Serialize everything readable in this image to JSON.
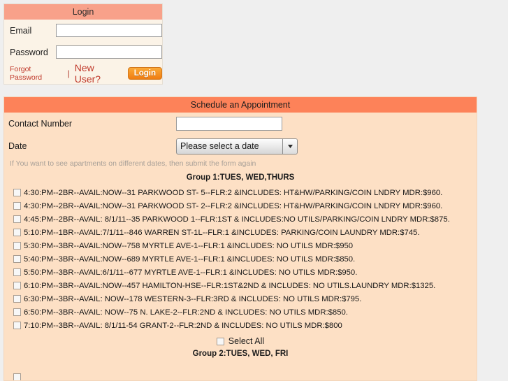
{
  "login": {
    "header": "Login",
    "email_label": "Email",
    "email_value": "",
    "email_placeholder": "",
    "password_label": "Password",
    "password_value": "",
    "password_placeholder": "",
    "forgot_password_label": "Forgot Password",
    "separator": "|",
    "new_user_label": "New User?",
    "login_button_label": "Login",
    "header_color": "#f8a18a",
    "button_color": "#f07d12",
    "link_color": "#c0392b"
  },
  "appointment": {
    "header": "Schedule an Appointment",
    "header_color": "#fd8259",
    "panel_color": "#fde0c5",
    "contact_number_label": "Contact Number",
    "contact_number_value": "",
    "contact_number_placeholder": "",
    "date_label": "Date",
    "date_selected": "Please select a date",
    "date_options": [
      "Please select a date"
    ],
    "hint": "If You want to see apartments on different dates, then submit the form again",
    "groups": [
      {
        "title": "Group 1:TUES, WED,THURS",
        "items": [
          {
            "label": "4:30:PM--2BR--AVAIL:NOW--31 PARKWOOD ST- 5--FLR:2 &INCLUDES: HT&HW/PARKING/COIN LNDRY MDR:$960.",
            "checked": false
          },
          {
            "label": "4:30:PM--2BR--AVAIL:NOW--31 PARKWOOD ST- 2--FLR:2 &INCLUDES: HT&HW/PARKING/COIN LNDRY MDR:$960.",
            "checked": false
          },
          {
            "label": "4:45:PM--2BR--AVAIL: 8/1/11--35 PARKWOOD 1--FLR:1ST & INCLUDES:NO UTILS/PARKING/COIN LNDRY MDR:$875.",
            "checked": false
          },
          {
            "label": "5:10:PM--1BR--AVAIL:7/1/11--846 WARREN ST-1L--FLR:1 &INCLUDES: PARKING/COIN LAUNDRY MDR:$745.",
            "checked": false
          },
          {
            "label": "5:30:PM--3BR--AVAIL:NOW--758 MYRTLE AVE-1--FLR:1 &INCLUDES: NO UTILS MDR:$950",
            "checked": false
          },
          {
            "label": "5:40:PM--3BR--AVAIL:NOW--689 MYRTLE AVE-1--FLR:1 &INCLUDES: NO UTILS MDR:$850.",
            "checked": false
          },
          {
            "label": "5:50:PM--3BR--AVAIL:6/1/11--677 MYRTLE AVE-1--FLR:1 &INCLUDES: NO UTILS MDR:$950.",
            "checked": false
          },
          {
            "label": "6:10:PM--3BR--AVAIL:NOW--457 HAMILTON-HSE--FLR:1ST&2ND & INCLUDES: NO UTILS.LAUNDRY MDR:$1325.",
            "checked": false
          },
          {
            "label": "6:30:PM--3BR--AVAIL: NOW--178 WESTERN-3--FLR:3RD & INCLUDES: NO UTILS MDR:$795.",
            "checked": false
          },
          {
            "label": "6:50:PM--3BR--AVAIL: NOW--75 N. LAKE-2--FLR:2ND & INCLUDES: NO UTILS MDR:$850.",
            "checked": false
          },
          {
            "label": "7:10:PM--3BR--AVAIL: 8/1/11-54 GRANT-2--FLR:2ND & INCLUDES: NO UTILS MDR:$800",
            "checked": false
          }
        ],
        "select_all_label": "Select All",
        "select_all_checked": false
      },
      {
        "title": "Group 2:TUES, WED, FRI",
        "items": [
          {
            "label": "",
            "checked": false
          }
        ]
      }
    ]
  },
  "icons": {
    "chevron_down": "chevron-down-icon"
  }
}
